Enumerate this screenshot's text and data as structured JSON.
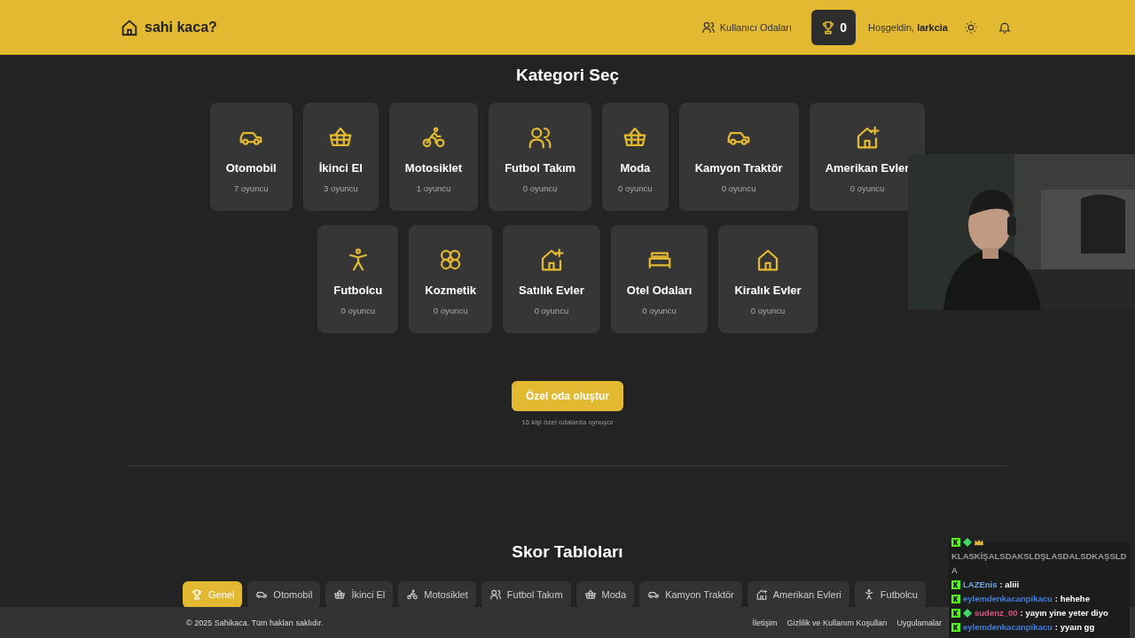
{
  "header": {
    "logo": "sahi kaca?",
    "rooms_link": "Kullanıcı Odaları",
    "trophy_count": "0",
    "greeting": "Hoşgeldin,",
    "username": "larkcia"
  },
  "categories_title": "Kategori Seç",
  "categories": [
    {
      "kind": "car",
      "name": "Otomobil",
      "players": "7 oyuncu"
    },
    {
      "kind": "basket",
      "name": "İkinci El",
      "players": "3 oyuncu"
    },
    {
      "kind": "bike",
      "name": "Motosiklet",
      "players": "1 oyuncu"
    },
    {
      "kind": "users",
      "name": "Futbol Takım",
      "players": "0 oyuncu"
    },
    {
      "kind": "basket",
      "name": "Moda",
      "players": "0 oyuncu"
    },
    {
      "kind": "car",
      "name": "Kamyon Traktör",
      "players": "0 oyuncu"
    },
    {
      "kind": "houseplus",
      "name": "Amerikan Evler",
      "players": "0 oyuncu"
    },
    {
      "kind": "person",
      "name": "Futbolcu",
      "players": "0 oyuncu"
    },
    {
      "kind": "flower",
      "name": "Kozmetik",
      "players": "0 oyuncu"
    },
    {
      "kind": "houseplus",
      "name": "Satılık Evler",
      "players": "0 oyuncu"
    },
    {
      "kind": "bed",
      "name": "Otel Odaları",
      "players": "0 oyuncu"
    },
    {
      "kind": "house",
      "name": "Kiralık Evler",
      "players": "0 oyuncu"
    }
  ],
  "private_room": {
    "button": "Özel oda oluştur",
    "note": "16 kişi özel odalarda oynuyor"
  },
  "scoreboards": {
    "title": "Skor Tabloları",
    "tabs": [
      {
        "kind": "trophy",
        "label": "Genel",
        "selected": true
      },
      {
        "kind": "car",
        "label": "Otomobil",
        "selected": false
      },
      {
        "kind": "basket",
        "label": "İkinci El",
        "selected": false
      },
      {
        "kind": "bike",
        "label": "Motosiklet",
        "selected": false
      },
      {
        "kind": "users",
        "label": "Futbol Takım",
        "selected": false
      },
      {
        "kind": "basket",
        "label": "Moda",
        "selected": false
      },
      {
        "kind": "car",
        "label": "Kamyon Traktör",
        "selected": false
      },
      {
        "kind": "houseplus",
        "label": "Amerikan Evleri",
        "selected": false
      },
      {
        "kind": "person",
        "label": "Futbolcu",
        "selected": false
      }
    ]
  },
  "footer": {
    "copyright": "© 2025 Sahikaca. Tüm hakları saklıdır.",
    "links": [
      "İletişim",
      "Gizlilik ve Kullanım Koşulları",
      "Uygulamalar"
    ]
  },
  "chat": [
    {
      "faded": true,
      "kick_badge": true,
      "diamond_badge": true,
      "crown_badge": true,
      "text": "KLASKİŞALSDAKSLDŞLASDALSDKAŞSLDA"
    },
    {
      "faded": false,
      "kick_badge": true,
      "user": "LAZEnis",
      "color": "#6fa8e8",
      "text": ": aliii"
    },
    {
      "faded": false,
      "kick_badge": true,
      "user": "eylemdenkacanpikacu",
      "color": "#3f7ee0",
      "text": ": hehehe"
    },
    {
      "faded": false,
      "kick_badge": true,
      "diamond_badge": true,
      "user": "sudenz_00",
      "color": "#d9577f",
      "text": ": yayın yine yeter diyo"
    },
    {
      "faded": false,
      "kick_badge": true,
      "user": "eylemdenkacanpikacu",
      "color": "#3f7ee0",
      "text": ": yyaın gg"
    }
  ]
}
